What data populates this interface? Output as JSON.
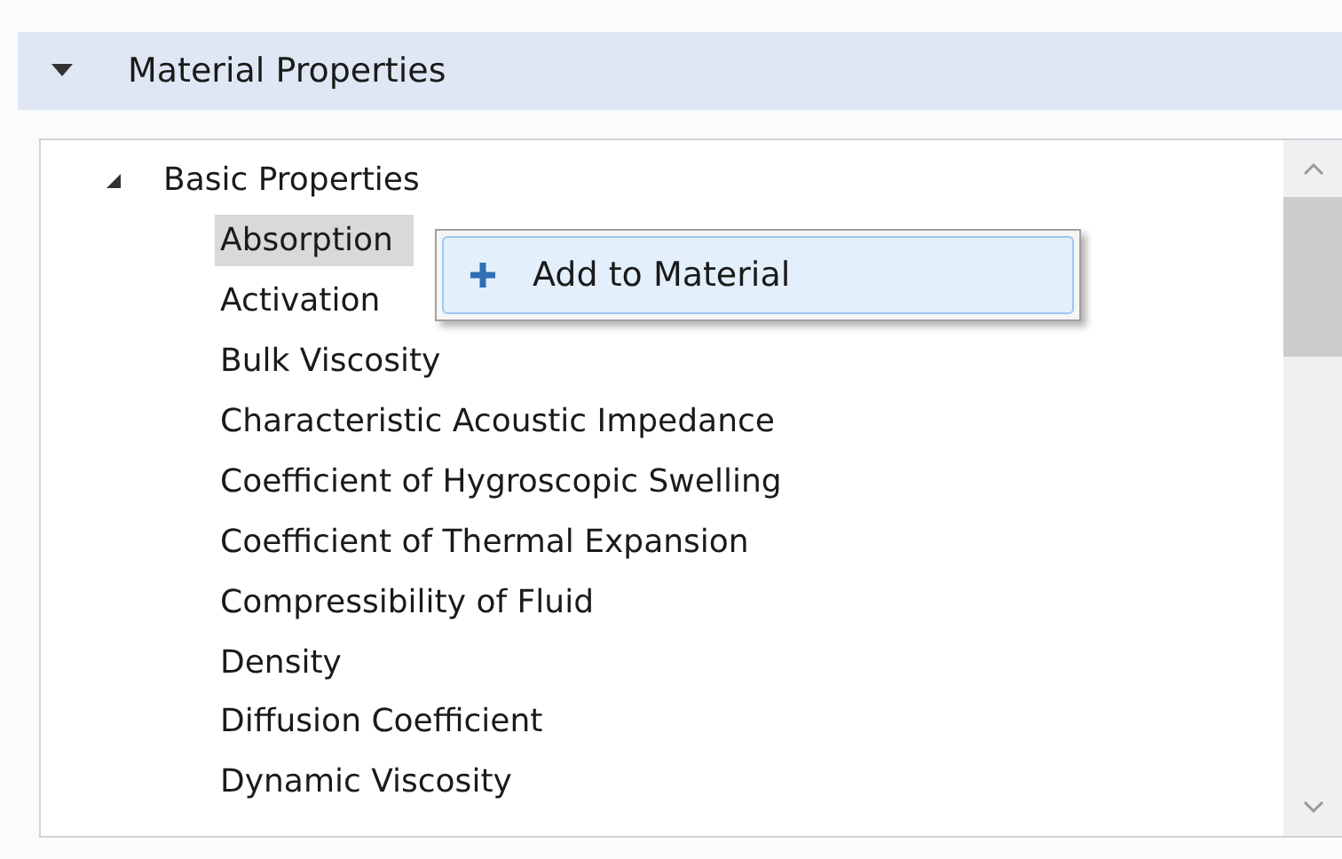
{
  "section": {
    "title": "Material Properties",
    "expanded": true
  },
  "tree": [
    {
      "label": "Basic Properties",
      "expanded": true,
      "children": [
        {
          "label": "Absorption",
          "selected": true
        },
        {
          "label": "Activation",
          "selected": false
        },
        {
          "label": "Bulk Viscosity",
          "selected": false
        },
        {
          "label": "Characteristic Acoustic Impedance",
          "selected": false
        },
        {
          "label": "Coefficient of Hygroscopic Swelling",
          "selected": false
        },
        {
          "label": "Coefficient of Thermal Expansion",
          "selected": false
        },
        {
          "label": "Compressibility of Fluid",
          "selected": false
        },
        {
          "label": "Density",
          "selected": false
        },
        {
          "label": "Diffusion Coefficient",
          "selected": false
        },
        {
          "label": "Dynamic Viscosity",
          "selected": false
        }
      ]
    }
  ],
  "context_menu": {
    "items": [
      {
        "label": "Add to Material",
        "highlighted": true
      }
    ]
  }
}
